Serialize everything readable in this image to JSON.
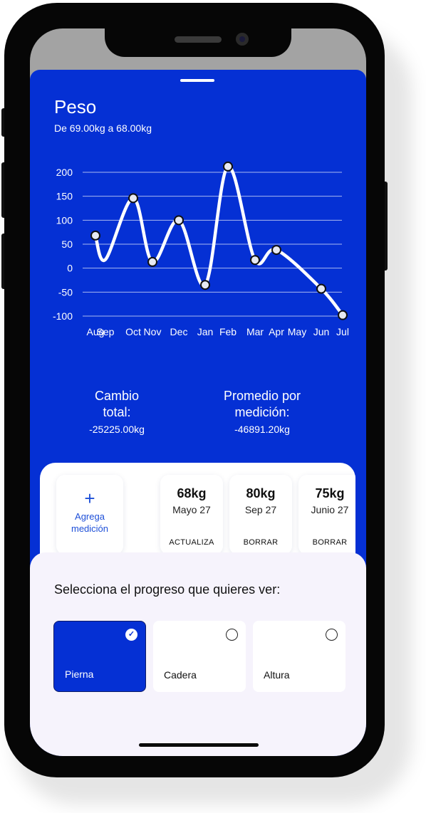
{
  "header": {
    "title": "Peso",
    "subtitle": "De 69.00kg a 68.00kg"
  },
  "chart_data": {
    "type": "line",
    "title": "",
    "xlabel": "",
    "ylabel": "",
    "categories": [
      "Aug",
      "Sep",
      "Oct",
      "Nov",
      "Dec",
      "Jan",
      "Feb",
      "Mar",
      "Apr",
      "May",
      "Jun",
      "Jul"
    ],
    "yticks": [
      200,
      150,
      100,
      50,
      0,
      -50,
      -100
    ],
    "ylim": [
      -100,
      200
    ],
    "grid": true,
    "series": [
      {
        "values": [
          68,
          18,
          146,
          13,
          100,
          -35,
          212,
          17,
          38,
          null,
          -43,
          -98
        ],
        "markers": [
          true,
          false,
          true,
          true,
          true,
          true,
          true,
          true,
          true,
          false,
          true,
          true
        ]
      }
    ],
    "colors": {
      "line": "#ffffff",
      "grid": "#a9b7f0",
      "marker_fill": "#e6e9f2",
      "marker_stroke": "#111111"
    }
  },
  "stats": {
    "total_label": [
      "Cambio",
      "total:"
    ],
    "total_value": "-25225.00kg",
    "average_label": [
      "Promedio por",
      "medición:"
    ],
    "average_value": "-46891.20kg"
  },
  "history": {
    "add_icon": "plus-icon",
    "add_label": [
      "Agrega",
      "medición"
    ],
    "entries": [
      {
        "value": "68kg",
        "date": "Mayo 27",
        "action": "ACTUALIZA"
      },
      {
        "value": "80kg",
        "date": "Sep 27",
        "action": "BORRAR"
      },
      {
        "value": "75kg",
        "date": "Junio 27",
        "action": "BORRAR"
      }
    ]
  },
  "progress": {
    "prompt": "Selecciona el progreso que quieres ver:",
    "options": [
      {
        "label": "Pierna",
        "selected": true
      },
      {
        "label": "Cadera",
        "selected": false
      },
      {
        "label": "Altura",
        "selected": false
      }
    ]
  },
  "colors": {
    "accent": "#0530d4",
    "link": "#1d4fd8",
    "panel": "#f6f3fc"
  }
}
